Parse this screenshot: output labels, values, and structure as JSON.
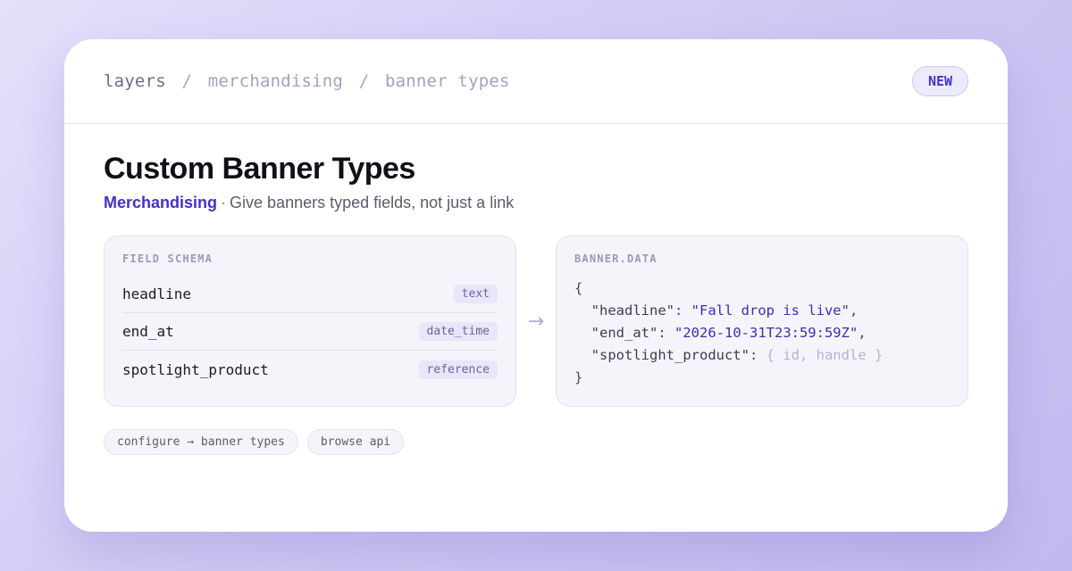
{
  "breadcrumb": [
    "layers",
    "merchandising",
    "banner types"
  ],
  "breadcrumb_separator": "/",
  "badge": "NEW",
  "title": "Custom Banner Types",
  "subtitle": {
    "category": "Merchandising",
    "separator": "·",
    "description": "Give banners typed fields, not just a link"
  },
  "schema_panel": {
    "title": "FIELD SCHEMA",
    "fields": [
      {
        "name": "headline",
        "type": "text"
      },
      {
        "name": "end_at",
        "type": "date_time"
      },
      {
        "name": "spotlight_product",
        "type": "reference"
      }
    ]
  },
  "arrow": "→",
  "data_panel": {
    "title": "BANNER.DATA",
    "open_brace": "{",
    "close_brace": "}",
    "entries": [
      {
        "key": "\"headline\"",
        "value": "\"Fall drop is live\"",
        "trailing": ","
      },
      {
        "key": "\"end_at\"",
        "value": "\"2026-10-31T23:59:59Z\"",
        "trailing": ","
      },
      {
        "key": "\"spotlight_product\"",
        "value": "{ id, handle }",
        "trailing": ""
      }
    ]
  },
  "links": [
    "configure → banner types",
    "browse api"
  ],
  "colors": {
    "accent": "#4331c9",
    "background_start": "#e3e0fb",
    "background_end": "#c2b9ef"
  }
}
